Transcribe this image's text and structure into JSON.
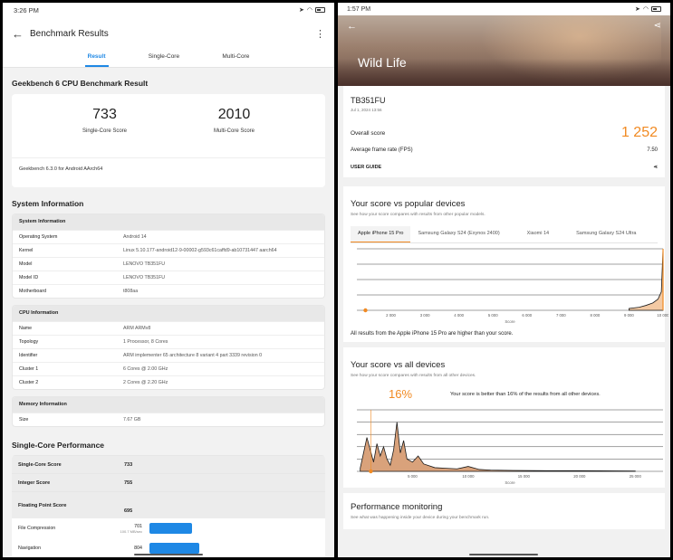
{
  "left": {
    "status": {
      "time": "3:26 PM"
    },
    "appbar": {
      "title": "Benchmark Results",
      "back_icon": "arrow-left-icon",
      "more_icon": "more-vert-icon"
    },
    "tabs": [
      "Result",
      "Single-Core",
      "Multi-Core"
    ],
    "heading": "Geekbench 6 CPU Benchmark Result",
    "single_score": "733",
    "single_label": "Single-Core Score",
    "multi_score": "2010",
    "multi_label": "Multi-Core Score",
    "version": "Geekbench 6.3.0 for Android AArch64",
    "system_heading": "System Information",
    "system_table": {
      "header": "System Information",
      "rows": [
        [
          "Operating System",
          "Android 14"
        ],
        [
          "Kernel",
          "Linux 5.10.177-android12-9-00002-g593c61caffd9-ab10731447 aarch64"
        ],
        [
          "Model",
          "LENOVO TB351FU"
        ],
        [
          "Model ID",
          "LENOVO TB351FU"
        ],
        [
          "Motherboard",
          "t808aa"
        ]
      ]
    },
    "cpu_table": {
      "header": "CPU Information",
      "rows": [
        [
          "Name",
          "ARM ARMv8"
        ],
        [
          "Topology",
          "1 Processor, 8 Cores"
        ],
        [
          "Identifier",
          "ARM implementer 65 architecture 8 variant 4 part 3339 revision 0"
        ],
        [
          "Cluster 1",
          "6 Cores @ 2.00 GHz"
        ],
        [
          "Cluster 2",
          "2 Cores @ 2.20 GHz"
        ]
      ]
    },
    "mem_table": {
      "header": "Memory Information",
      "rows": [
        [
          "Size",
          "7.67 GB"
        ]
      ]
    },
    "perf_heading": "Single-Core Performance",
    "perf_rows": [
      [
        "Single-Core Score",
        "733"
      ],
      [
        "Integer Score",
        "755"
      ],
      [
        "Floating Point Score",
        "695"
      ]
    ],
    "file_compression": {
      "label": "File Compression",
      "score": "701",
      "rate": "100.7 MB/sec",
      "bar_fraction": 0.47
    },
    "navigation": {
      "label": "Navigation",
      "score": "804",
      "bar_fraction": 0.55
    }
  },
  "right": {
    "status": {
      "time": "1:57 PM"
    },
    "hero_title": "Wild Life",
    "device": "TB351FU",
    "date": "Jul 1, 2024 13:56",
    "overall_label": "Overall score",
    "overall_value": "1 252",
    "fps_label": "Average frame rate (FPS)",
    "fps_value": "7.50",
    "user_guide": "USER GUIDE",
    "popular": {
      "title": "Your score vs popular devices",
      "desc": "See how your score compares with results from other popular models.",
      "tabs": [
        "Apple iPhone 15 Pro",
        "Samsung Galaxy S24 (Exynos 2400)",
        "Xiaomi 14",
        "Samsung Galaxy S24 Ultra"
      ],
      "note": "All results from the Apple iPhone 15 Pro are higher than your score."
    },
    "all": {
      "title": "Your score vs all devices",
      "desc": "See how your score compares with results from all other devices.",
      "percent": "16%",
      "text": "Your score is better than 16% of the results from all other devices."
    },
    "monitoring": {
      "title": "Performance monitoring",
      "desc": "See what was happening inside your device during your benchmark run."
    }
  },
  "chart_data": [
    {
      "type": "area",
      "xlabel": "Score",
      "x_ticks": [
        "2 000",
        "3 000",
        "4 000",
        "5 000",
        "6 000",
        "7 000",
        "8 000",
        "9 000",
        "10 000"
      ],
      "xlim": [
        1000,
        10000
      ],
      "marker_score": 1252,
      "series": [
        {
          "x": [
            9000,
            9300,
            9500,
            9700,
            9850,
            9950,
            10000
          ],
          "y": [
            0.03,
            0.05,
            0.08,
            0.12,
            0.18,
            0.3,
            1.0
          ]
        }
      ]
    },
    {
      "type": "area",
      "xlabel": "Score",
      "x_ticks": [
        "5 000",
        "10 000",
        "15 000",
        "20 000",
        "25 000"
      ],
      "xlim": [
        0,
        27500
      ],
      "marker_score": 1252,
      "series": [
        {
          "x": [
            300,
            600,
            900,
            1200,
            1500,
            1800,
            2100,
            2400,
            2700,
            3000,
            3300,
            3600,
            3900,
            4200,
            4500,
            5000,
            5500,
            6000,
            7000,
            8000,
            9000,
            10000,
            11000,
            12000,
            14000,
            17000,
            20000,
            25000
          ],
          "y": [
            0.05,
            0.3,
            0.55,
            0.35,
            0.15,
            0.45,
            0.25,
            0.4,
            0.2,
            0.1,
            0.35,
            0.8,
            0.3,
            0.5,
            0.2,
            0.15,
            0.25,
            0.12,
            0.06,
            0.05,
            0.04,
            0.08,
            0.03,
            0.02,
            0.015,
            0.01,
            0.01,
            0.005
          ]
        }
      ]
    }
  ]
}
